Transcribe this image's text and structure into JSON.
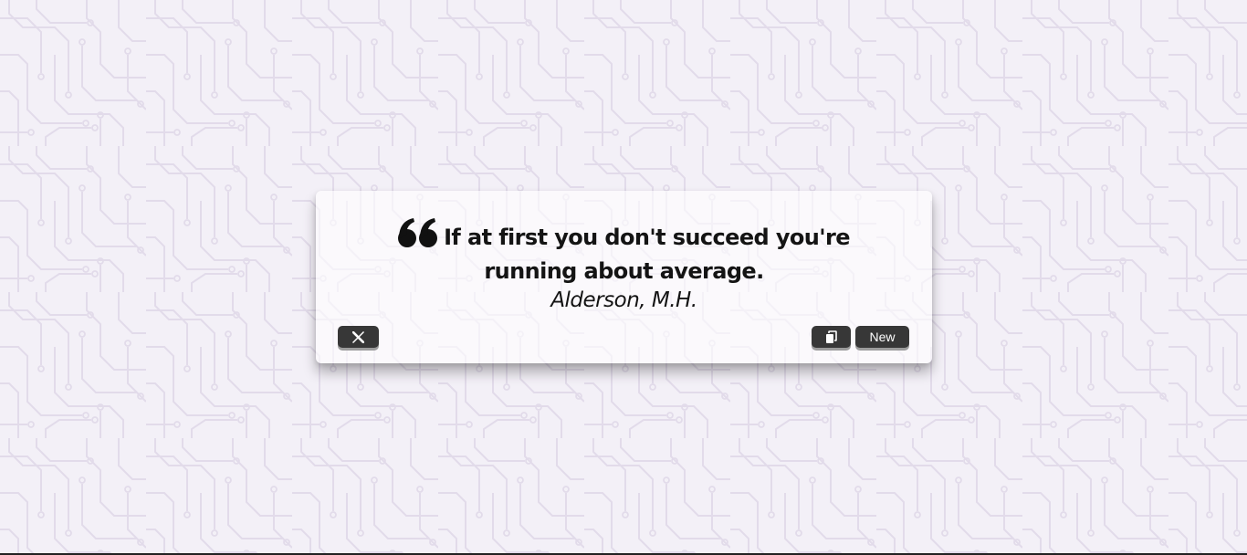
{
  "quote": {
    "text": "If at first you don't succeed you're running about average.",
    "author": "Alderson, M.H."
  },
  "actions": {
    "tweet_icon": "x-logo-icon",
    "copy_icon": "copy-icon",
    "new_label": "New"
  },
  "colors": {
    "background": "#f3f0f7",
    "circuit_lines": "#e2dbea",
    "button_bg": "#373737",
    "text": "#141414"
  }
}
